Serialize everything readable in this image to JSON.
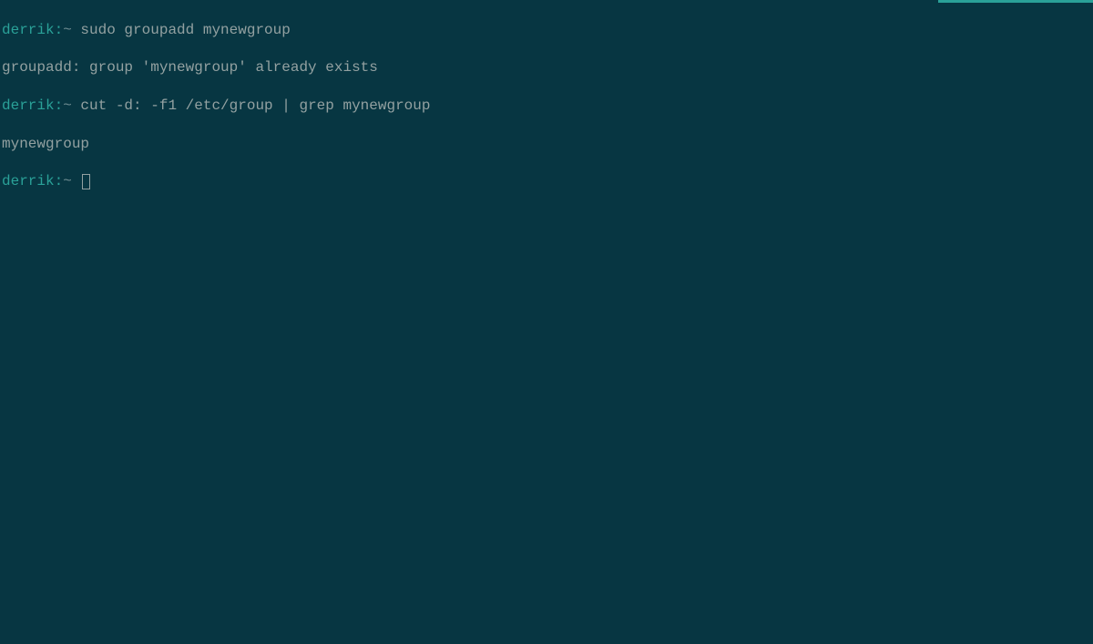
{
  "lines": [
    {
      "type": "prompt",
      "user": "derrik",
      "sep": ":",
      "path": "~ ",
      "command": "sudo groupadd mynewgroup"
    },
    {
      "type": "output",
      "text": "groupadd: group 'mynewgroup' already exists"
    },
    {
      "type": "prompt",
      "user": "derrik",
      "sep": ":",
      "path": "~ ",
      "command": "cut -d: -f1 /etc/group | grep mynewgroup"
    },
    {
      "type": "output",
      "text": "mynewgroup"
    },
    {
      "type": "prompt",
      "user": "derrik",
      "sep": ":",
      "path": "~ ",
      "command": "",
      "cursor": true
    }
  ]
}
